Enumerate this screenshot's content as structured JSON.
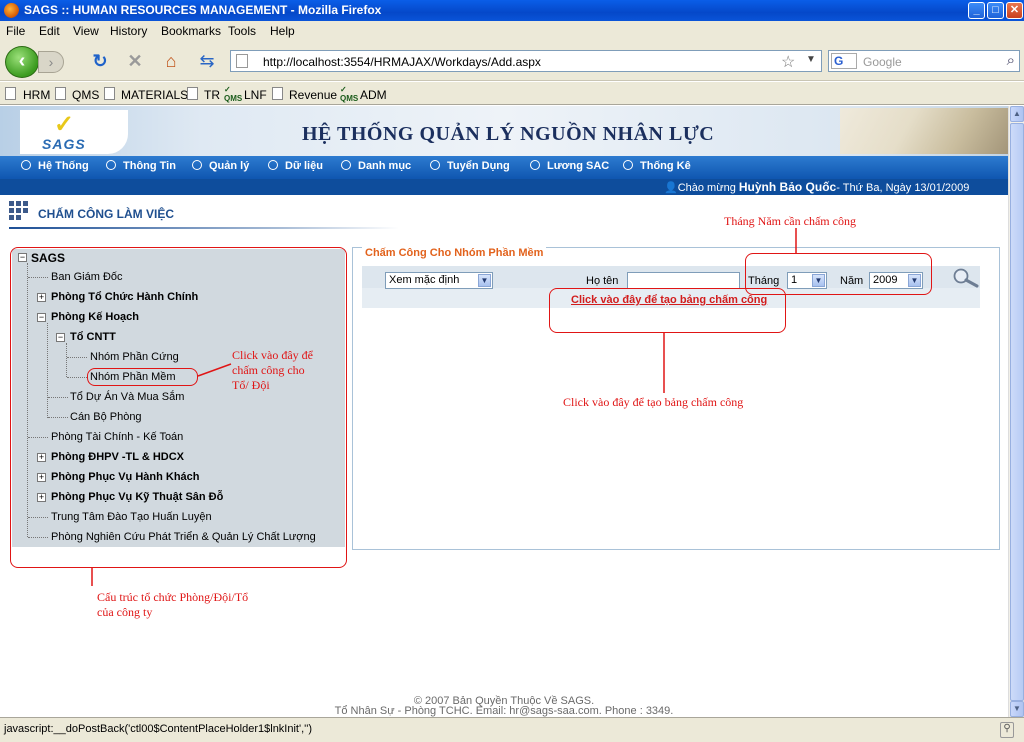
{
  "window": {
    "title": "SAGS :: HUMAN RESOURCES MANAGEMENT - Mozilla Firefox",
    "minimize": "_",
    "maximize": "□",
    "close": "✕"
  },
  "menu": [
    "File",
    "Edit",
    "View",
    "History",
    "Bookmarks",
    "Tools",
    "Help"
  ],
  "toolbar": {
    "url": "http://localhost:3554/HRMAJAX/Workdays/Add.aspx",
    "search_placeholder": "Google",
    "search_engine": "G",
    "icons": [
      "back-icon",
      "forward-icon",
      "reload-icon",
      "stop-icon",
      "home-icon",
      "rss-icon",
      "bookmark-star-icon",
      "search-icon"
    ]
  },
  "bookmarks": [
    {
      "label": "HRM",
      "icon": "page-icon"
    },
    {
      "label": "QMS",
      "icon": "page-icon"
    },
    {
      "label": "MATERIALS",
      "icon": "page-icon"
    },
    {
      "label": "TR",
      "icon": "page-icon"
    },
    {
      "label": "LNF",
      "icon": "qms-icon"
    },
    {
      "label": "Revenue",
      "icon": "page-icon"
    },
    {
      "label": "ADM",
      "icon": "qms-icon"
    }
  ],
  "banner": {
    "logo_text": "SAGS",
    "system_title": "HỆ THỐNG QUẢN LÝ NGUỒN NHÂN LỰC"
  },
  "nav": [
    "Hệ Thống",
    "Thông Tin",
    "Quản lý",
    "Dữ liệu",
    "Danh mục",
    "Tuyển Dụng",
    "Lương SAC",
    "Thống Kê"
  ],
  "welcome": {
    "prefix": "Chào mừng",
    "user": "Huỳnh Bảo Quốc",
    "date": "- Thứ Ba, Ngày 13/01/2009"
  },
  "page_title": "CHẤM CÔNG LÀM VIỆC",
  "tree": {
    "root": "SAGS",
    "nodes": [
      {
        "label": "Ban Giám Đốc",
        "bold": false
      },
      {
        "label": "Phòng Tổ Chức Hành Chính",
        "bold": true
      },
      {
        "label": "Phòng Kế Hoạch",
        "bold": true
      },
      {
        "label": "Tổ CNTT",
        "bold": true
      },
      {
        "label": "Nhóm Phần Cứng",
        "bold": false
      },
      {
        "label": "Nhóm Phần Mềm",
        "bold": false
      },
      {
        "label": "Tổ Dự Án Và Mua Sắm",
        "bold": false
      },
      {
        "label": "Cán Bộ Phòng",
        "bold": false
      },
      {
        "label": "Phòng Tài Chính - Kế Toán",
        "bold": false
      },
      {
        "label": "Phòng ĐHPV -TL & HDCX",
        "bold": true
      },
      {
        "label": "Phòng Phục Vụ Hành Khách",
        "bold": true
      },
      {
        "label": "Phòng Phục Vụ Kỹ Thuật Sân Đỗ",
        "bold": true
      },
      {
        "label": "Trung Tâm Đào Tạo Huấn Luyện",
        "bold": false
      },
      {
        "label": "Phòng Nghiên Cứu Phát Triển & Quản Lý Chất Lượng",
        "bold": false
      }
    ]
  },
  "form": {
    "legend": "Chấm Công Cho Nhóm Phần Mềm",
    "view_select": "Xem mặc định",
    "name_label": "Họ tên",
    "name_value": "",
    "month_label": "Tháng",
    "month_value": "1",
    "year_label": "Năm",
    "year_value": "2009",
    "create_link": "Click vào đây để tạo bảng chấm công"
  },
  "annotations": {
    "month_year": "Tháng Năm cần chấm công",
    "click_group_1": "Click vào đây để",
    "click_group_2": "chấm công cho",
    "click_group_3": "Tổ/ Đội",
    "create_table": "Click vào đây để tạo bảng chấm công",
    "structure_1": "Cấu trúc tổ chức Phòng/Đội/Tổ",
    "structure_2": "của công ty"
  },
  "footer": {
    "line1": "© 2007 Bản Quyền Thuộc Về SAGS.",
    "line2": "Tổ Nhân Sự - Phòng TCHC. Email: hr@sags-saa.com. Phone : 3349."
  },
  "statusbar": "javascript:__doPostBack('ctl00$ContentPlaceHolder1$lnkInit','')"
}
